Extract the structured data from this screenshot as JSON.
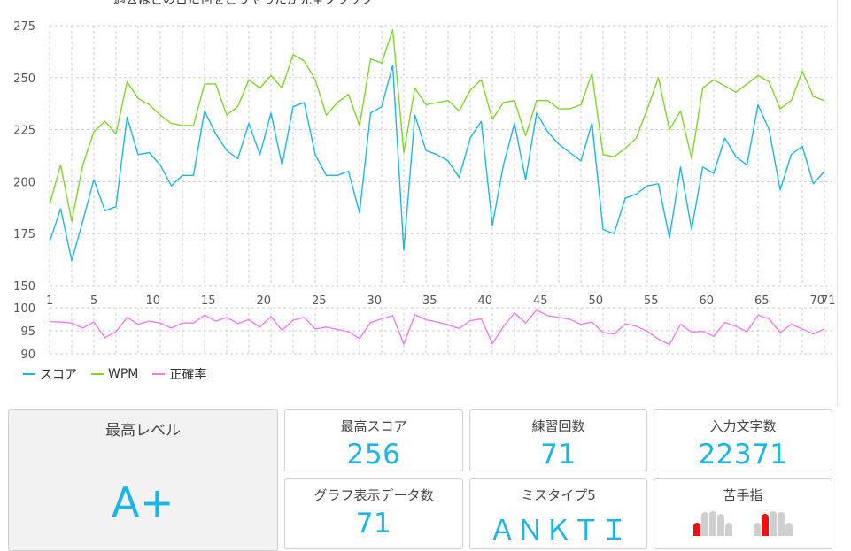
{
  "header": {
    "title_cut": "過去はどの日に何をどうやったか完全ブラック"
  },
  "chart_data": {
    "type": "line",
    "x": [
      1,
      2,
      3,
      4,
      5,
      6,
      7,
      8,
      9,
      10,
      11,
      12,
      13,
      14,
      15,
      16,
      17,
      18,
      19,
      20,
      21,
      22,
      23,
      24,
      25,
      26,
      27,
      28,
      29,
      30,
      31,
      32,
      33,
      34,
      35,
      36,
      37,
      38,
      39,
      40,
      41,
      42,
      43,
      44,
      45,
      46,
      47,
      48,
      49,
      50,
      51,
      52,
      53,
      54,
      55,
      56,
      57,
      58,
      59,
      60,
      61,
      62,
      63,
      64,
      65,
      66,
      67,
      68,
      69,
      70,
      71
    ],
    "upper": {
      "ylim": [
        150,
        275
      ],
      "yticks": [
        150,
        175,
        200,
        225,
        250,
        275
      ],
      "series": [
        {
          "name": "スコア",
          "color": "#1bb6e8",
          "values": [
            171,
            187,
            162,
            181,
            201,
            186,
            188,
            231,
            213,
            214,
            208,
            198,
            203,
            203,
            234,
            223,
            215,
            211,
            228,
            213,
            233,
            208,
            236,
            238,
            213,
            203,
            203,
            205,
            185,
            233,
            236,
            256,
            167,
            232,
            215,
            213,
            210,
            202,
            221,
            229,
            179,
            208,
            228,
            201,
            233,
            224,
            218,
            214,
            210,
            228,
            177,
            175,
            192,
            194,
            198,
            199,
            173,
            207,
            177,
            207,
            204,
            221,
            212,
            208,
            237,
            225,
            196,
            213,
            217,
            199,
            205
          ]
        },
        {
          "name": "WPM",
          "color": "#7fd629",
          "values": [
            189,
            208,
            181,
            208,
            224,
            229,
            223,
            248,
            240,
            237,
            232,
            228,
            227,
            227,
            247,
            247,
            232,
            236,
            249,
            245,
            251,
            245,
            261,
            258,
            249,
            232,
            238,
            242,
            227,
            259,
            257,
            273,
            214,
            245,
            237,
            238,
            239,
            234,
            244,
            249,
            230,
            238,
            239,
            222,
            239,
            239,
            235,
            235,
            237,
            252,
            213,
            212,
            216,
            221,
            235,
            250,
            225,
            234,
            211,
            245,
            249,
            246,
            243,
            247,
            251,
            248,
            235,
            239,
            253,
            241,
            239
          ]
        }
      ],
      "xticks": [
        1,
        5,
        10,
        15,
        20,
        25,
        30,
        35,
        40,
        45,
        50,
        55,
        60,
        65,
        70,
        71
      ]
    },
    "lower": {
      "ylim": [
        90,
        100
      ],
      "yticks": [
        90,
        95,
        100
      ],
      "series": [
        {
          "name": "正確率",
          "color": "#f27cf2",
          "values": [
            97,
            96.9,
            96.7,
            95.6,
            96.9,
            93.5,
            94.8,
            97.9,
            96.4,
            97.1,
            96.7,
            95.6,
            96.7,
            96.7,
            98.4,
            97.1,
            97.9,
            96.6,
            97.4,
            95.8,
            98.1,
            95.1,
            97.3,
            97.9,
            95.4,
            95.8,
            95.3,
            94.8,
            93.3,
            96.8,
            97.6,
            98.3,
            92.1,
            98.5,
            97.4,
            96.9,
            96.3,
            95.5,
            97.2,
            97.6,
            92.2,
            95.9,
            98.9,
            96.7,
            99.5,
            98.3,
            97.9,
            97.5,
            96.4,
            96.9,
            94.6,
            94.3,
            96.5,
            96,
            94.9,
            93.2,
            92,
            96.4,
            94.7,
            94.9,
            93.8,
            96.8,
            96,
            94.8,
            98.4,
            97.6,
            94.6,
            96.4,
            95.4,
            94.3,
            95.4
          ]
        }
      ]
    }
  },
  "legend": [
    {
      "label": "スコア",
      "color": "#1bb6e8"
    },
    {
      "label": "WPM",
      "color": "#7fd629"
    },
    {
      "label": "正確率",
      "color": "#f27cf2"
    }
  ],
  "stats": {
    "max_level": {
      "label": "最高レベル",
      "value": "A+"
    },
    "max_score": {
      "label": "最高スコア",
      "value": "256"
    },
    "practice_count": {
      "label": "練習回数",
      "value": "71"
    },
    "char_count": {
      "label": "入力文字数",
      "value": "22371"
    },
    "graph_count": {
      "label": "グラフ表示データ数",
      "value": "71"
    },
    "mistype": {
      "label": "ミスタイプ5",
      "value": "ＡＮＫＴＩ"
    },
    "weak_finger": {
      "label": "苦手指",
      "left_hand": [
        {
          "level": 0.55,
          "weak": true
        },
        {
          "level": 0.95,
          "weak": false
        },
        {
          "level": 1.0,
          "weak": false
        },
        {
          "level": 0.9,
          "weak": false
        },
        {
          "level": 0.55,
          "weak": false
        }
      ],
      "right_hand": [
        {
          "level": 0.55,
          "weak": false
        },
        {
          "level": 0.9,
          "weak": true
        },
        {
          "level": 1.0,
          "weak": false
        },
        {
          "level": 0.95,
          "weak": false
        },
        {
          "level": 0.55,
          "weak": false
        }
      ]
    }
  }
}
